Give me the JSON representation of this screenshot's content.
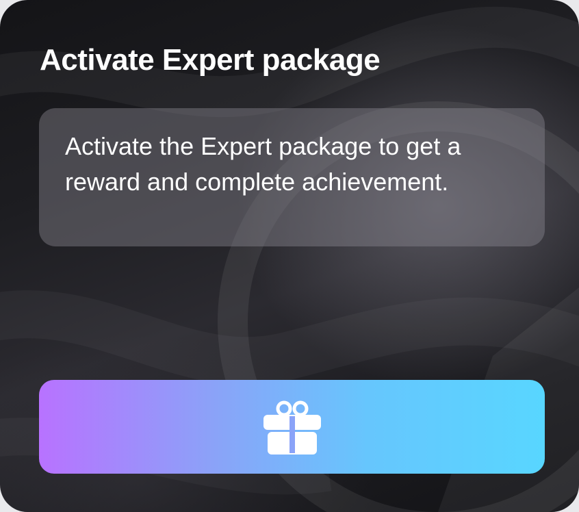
{
  "card": {
    "title": "Activate Expert package",
    "description": "Activate the Expert package to get a reward and complete achievement."
  },
  "reward_button": {
    "icon": "gift-icon",
    "gradient_start": "#b872ff",
    "gradient_end": "#58d6ff"
  },
  "colors": {
    "background": "#1d1d21",
    "text": "#ffffff",
    "panel": "rgba(140,138,148,0.42)"
  }
}
